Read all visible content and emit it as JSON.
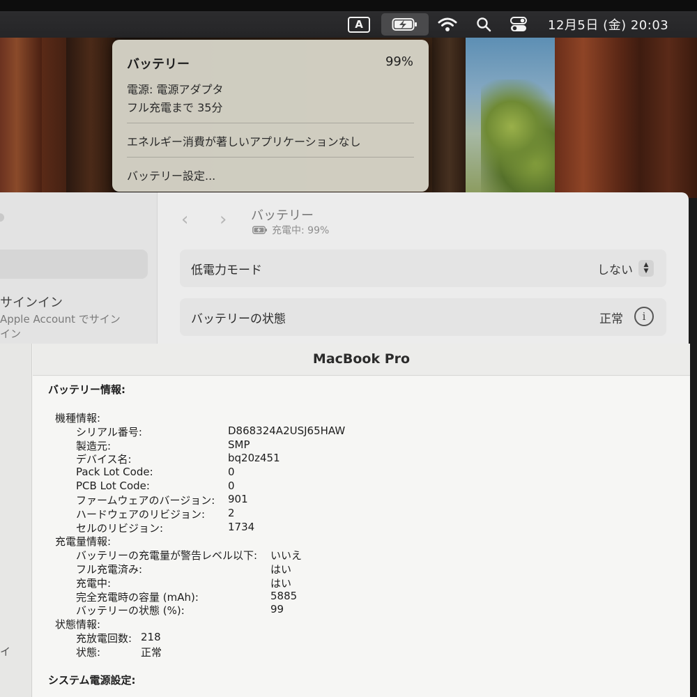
{
  "menubar": {
    "input_source": "A",
    "clock": "12月5日 (金)  20:03",
    "icons": [
      "input-source-icon",
      "battery-charging-icon",
      "wifi-icon",
      "search-icon",
      "control-center-icon"
    ]
  },
  "battery_menu": {
    "title": "バッテリー",
    "percent": "99%",
    "power_source": "電源: 電源アダプタ",
    "time_to_full": "フル充電まで 35分",
    "energy_apps": "エネルギー消費が著しいアプリケーションなし",
    "settings_item": "バッテリー設定..."
  },
  "settings": {
    "sidebar": {
      "signin": "サインイン",
      "account_line1": "Apple Account でサイン",
      "account_line2": "イン"
    },
    "header": {
      "title": "バッテリー",
      "subtitle": "充電中: 99%"
    },
    "rows": {
      "low_power_label": "低電力モード",
      "low_power_value": "しない",
      "health_label": "バッテリーの状態",
      "health_value": "正常"
    }
  },
  "sysinfo": {
    "window_title": "MacBook Pro",
    "left_glyph": "イ",
    "section_title": "バッテリー情報:",
    "model_group": "機種情報:",
    "model": [
      {
        "label": "シリアル番号:",
        "value": "D868324A2USJ65HAW"
      },
      {
        "label": "製造元:",
        "value": "SMP"
      },
      {
        "label": "デバイス名:",
        "value": "bq20z451"
      },
      {
        "label": "Pack Lot Code:",
        "value": "0"
      },
      {
        "label": "PCB Lot Code:",
        "value": "0"
      },
      {
        "label": "ファームウェアのバージョン:",
        "value": "901"
      },
      {
        "label": "ハードウェアのリビジョン:",
        "value": "2"
      },
      {
        "label": "セルのリビジョン:",
        "value": "1734"
      }
    ],
    "charge_group": "充電量情報:",
    "charge": [
      {
        "label": "バッテリーの充電量が警告レベル以下:",
        "value": "いいえ"
      },
      {
        "label": "フル充電済み:",
        "value": "はい"
      },
      {
        "label": "充電中:",
        "value": "はい"
      },
      {
        "label": "完全充電時の容量 (mAh):",
        "value": "5885"
      },
      {
        "label": "バッテリーの状態 (%):",
        "value": "99"
      }
    ],
    "status_group": "状態情報:",
    "status": [
      {
        "label": "充放電回数:",
        "value": "218"
      },
      {
        "label": "状態:",
        "value": "正常"
      }
    ],
    "power_section_title": "システム電源設定:"
  }
}
